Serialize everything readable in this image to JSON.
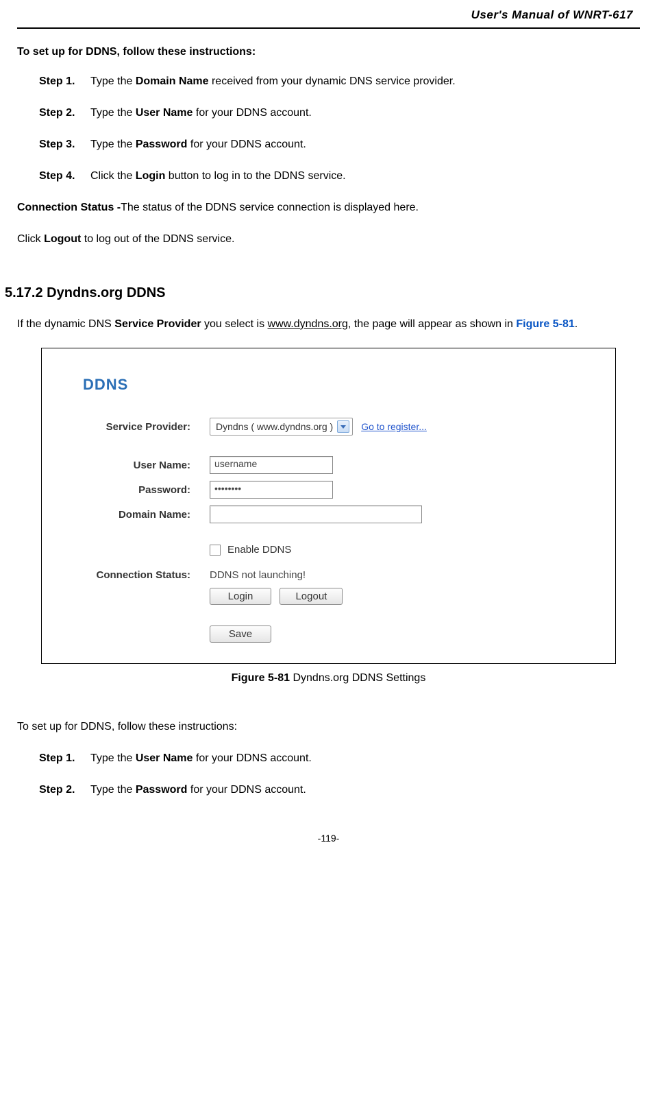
{
  "header": {
    "title": "User's Manual of WNRT-617"
  },
  "section1": {
    "intro": "To set up for DDNS, follow these instructions:",
    "steps": [
      {
        "label": "Step 1.",
        "pre": "Type the ",
        "bold": "Domain Name",
        "post": " received from your dynamic DNS service provider."
      },
      {
        "label": "Step 2.",
        "pre": "Type the ",
        "bold": "User Name",
        "post": " for your DDNS account."
      },
      {
        "label": "Step 3.",
        "pre": "Type the ",
        "bold": "Password",
        "post": " for your DDNS account."
      },
      {
        "label": "Step 4.",
        "pre": "Click the ",
        "bold": "Login",
        "post": " button to log in to the DDNS service."
      }
    ],
    "conn_label": "Connection Status -",
    "conn_text": "The status of the DDNS service connection is displayed here.",
    "logout_pre": "Click ",
    "logout_bold": "Logout",
    "logout_post": " to log out of the DDNS service."
  },
  "section2": {
    "heading": "5.17.2  Dyndns.org DDNS",
    "intro_pre": "If the dynamic DNS ",
    "intro_bold": "Service Provider",
    "intro_mid": " you select is ",
    "intro_link": "www.dyndns.org",
    "intro_post": ", the page will appear as shown in ",
    "fig_ref": "Figure 5-81",
    "intro_end": "."
  },
  "screenshot": {
    "title": "DDNS",
    "labels": {
      "service_provider": "Service Provider:",
      "user_name": "User Name:",
      "password": "Password:",
      "domain_name": "Domain Name:",
      "enable": "Enable DDNS",
      "connection_status": "Connection Status:"
    },
    "values": {
      "provider_option": "Dyndns ( www.dyndns.org )",
      "register_link": "Go to register...",
      "username": "username",
      "password_mask": "••••••••",
      "domain": "",
      "status": "DDNS not launching!"
    },
    "buttons": {
      "login": "Login",
      "logout": "Logout",
      "save": "Save"
    }
  },
  "caption": {
    "bold": "Figure 5-81",
    "plain": "    Dyndns.org DDNS Settings"
  },
  "section3": {
    "intro": "To set up for DDNS, follow these instructions:",
    "steps": [
      {
        "label": "Step 1.",
        "pre": "Type the ",
        "bold": "User Name",
        "post": " for your DDNS account."
      },
      {
        "label": "Step 2.",
        "pre": "Type the ",
        "bold": "Password",
        "post": " for your DDNS account."
      }
    ]
  },
  "footer": {
    "page": "-119-"
  }
}
